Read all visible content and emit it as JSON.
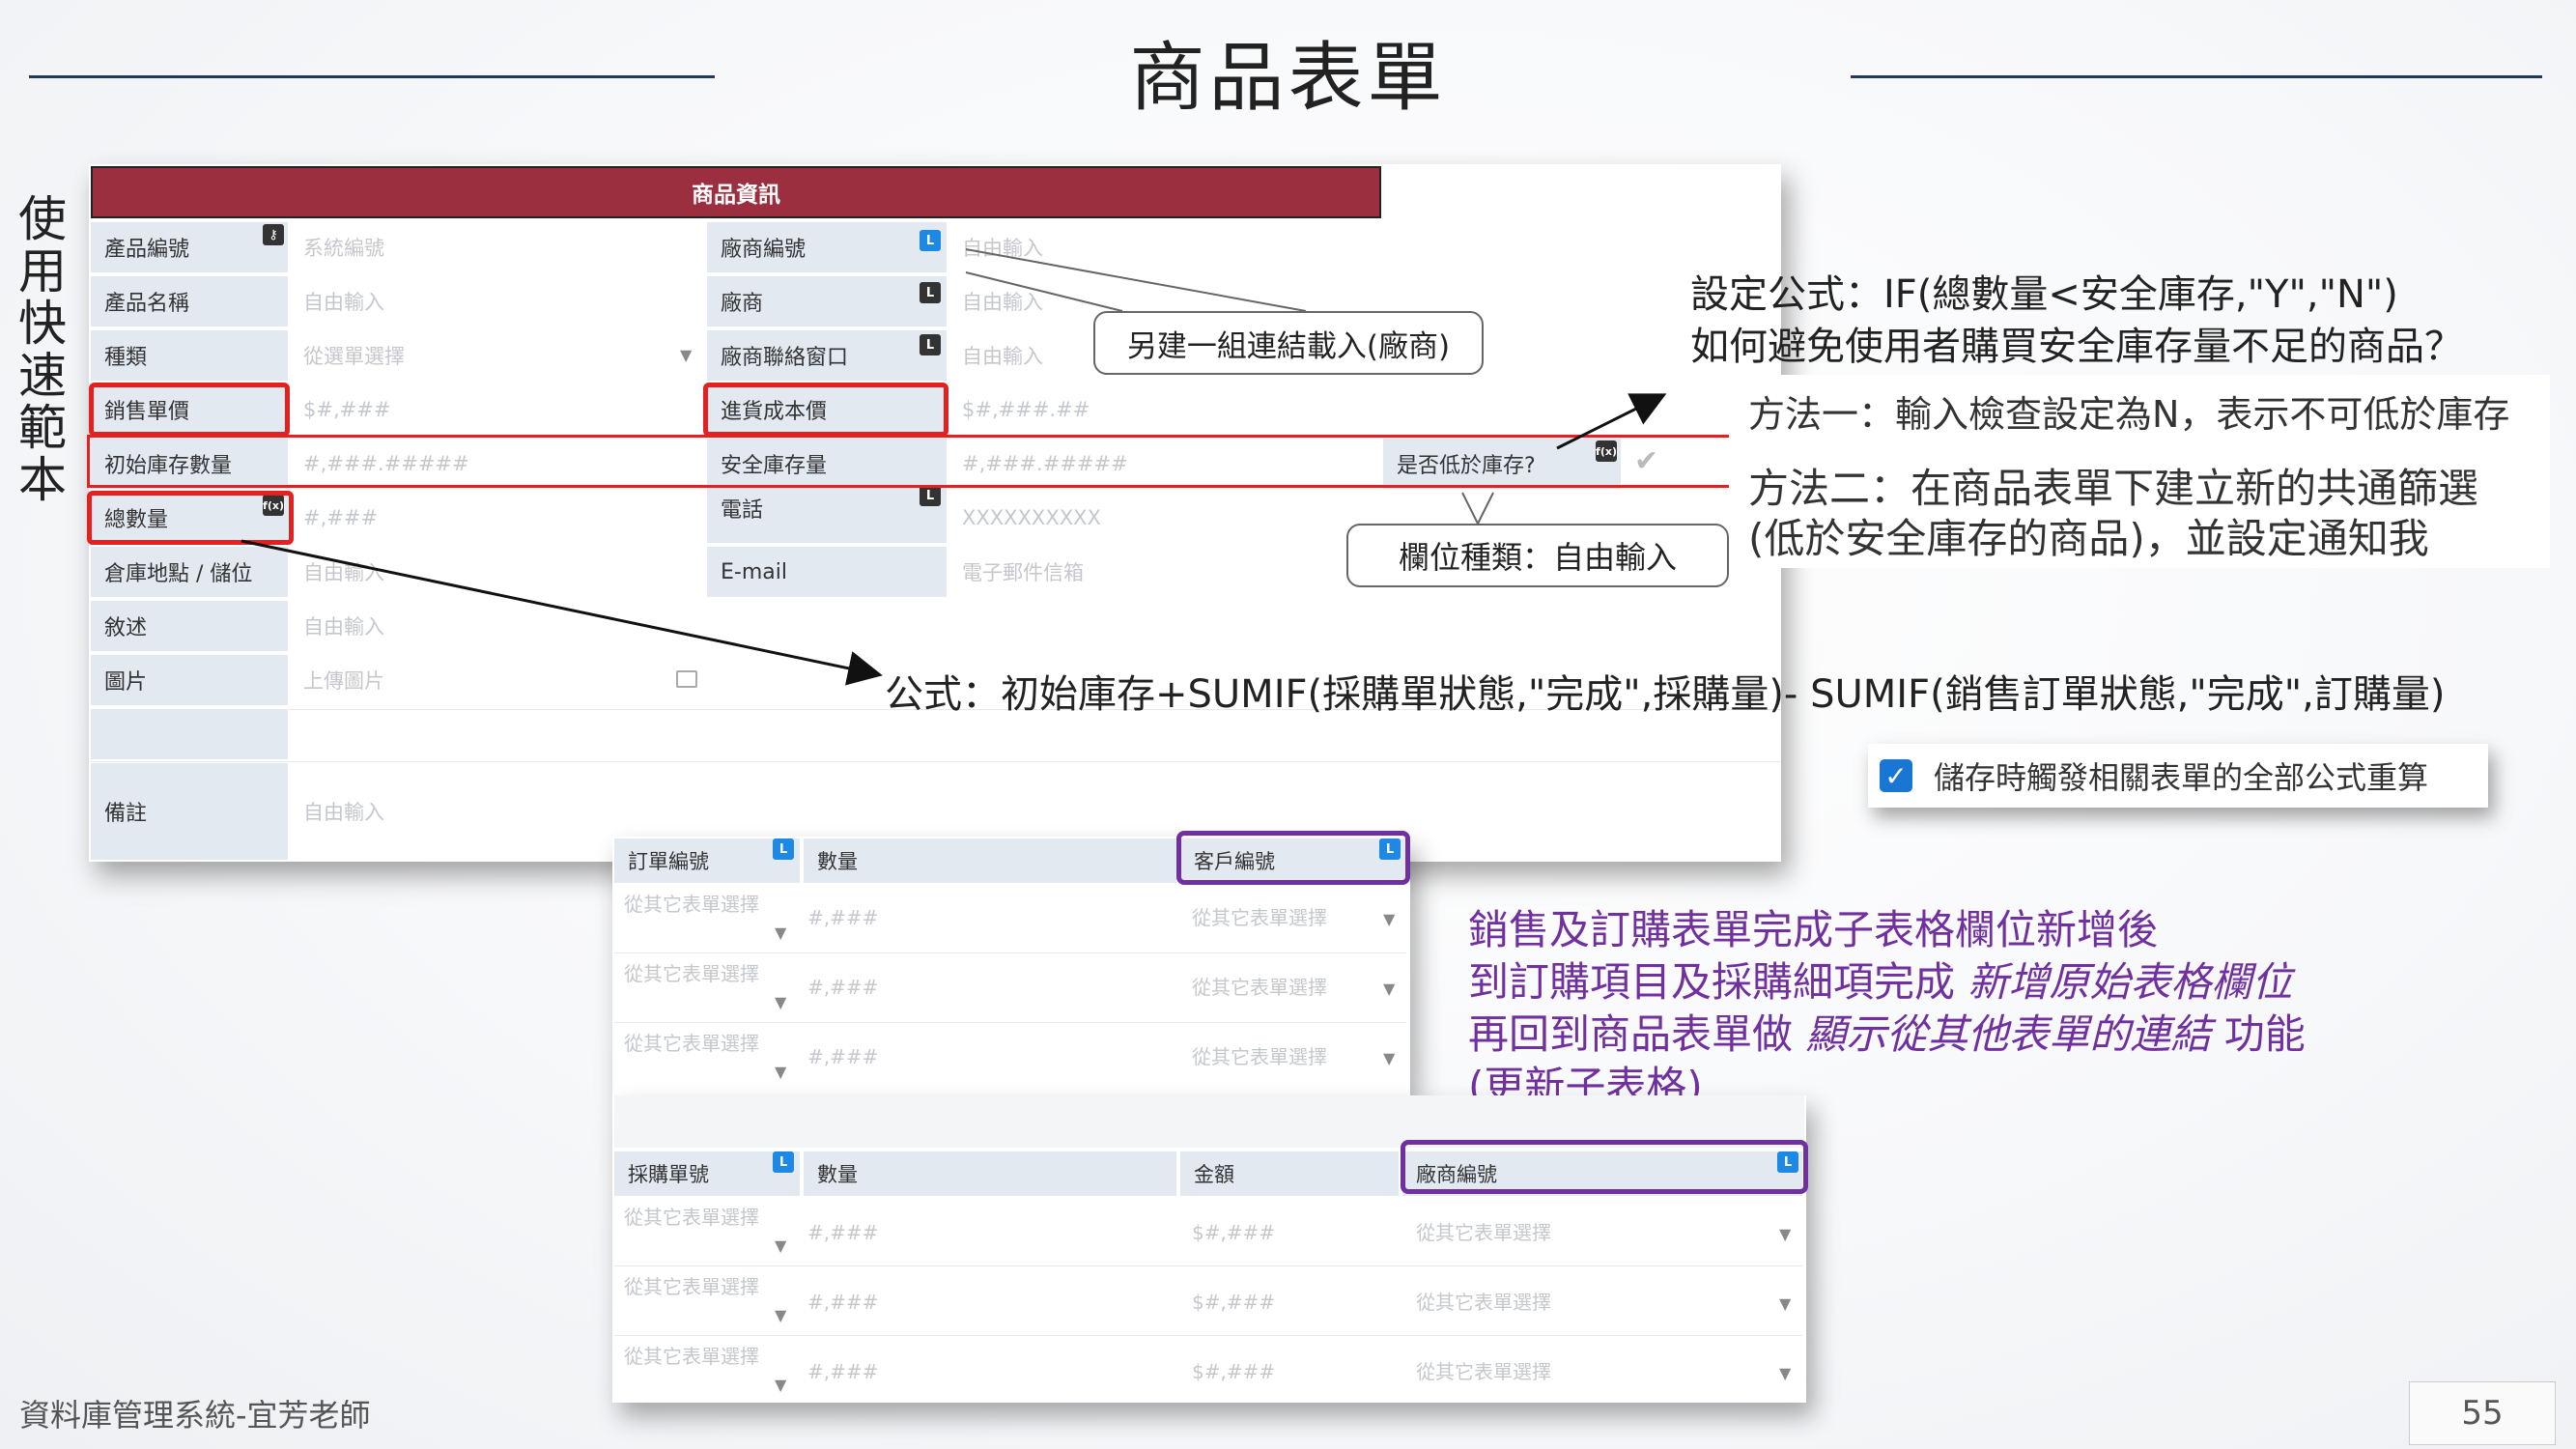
{
  "title": "商品表單",
  "side_title": "使用快速範本",
  "form": {
    "header": "商品資訊",
    "rows": [
      {
        "label": "產品編號",
        "value": "系統編號",
        "label2": "廠商編號",
        "value2": "自由輸入"
      },
      {
        "label": "產品名稱",
        "value": "自由輸入",
        "label2": "廠商",
        "value2": "自由輸入"
      },
      {
        "label": "種類",
        "value": "從選單選擇",
        "label2": "廠商聯絡窗口",
        "value2": "自由輸入"
      },
      {
        "label": "銷售單價",
        "value": "$#,###",
        "label2": "進貨成本價",
        "value2": "$#,###.##"
      },
      {
        "label": "初始庫存數量",
        "value": "#,###.#####",
        "label2": "安全庫存量",
        "value2": "#,###.#####",
        "label3": "是否低於庫存?"
      },
      {
        "label": "總數量",
        "value": "#,###",
        "label2": "電話",
        "value2": "XXXXXXXXXX"
      },
      {
        "label": "倉庫地點 / 儲位",
        "value": "自由輸入",
        "label2": "E-mail",
        "value2": "電子郵件信箱"
      },
      {
        "label": "敘述",
        "value": "自由輸入"
      },
      {
        "label": "圖片",
        "value": "上傳圖片"
      },
      {
        "label": "備註",
        "value": "自由輸入"
      }
    ]
  },
  "callouts": {
    "link": "另建一組連結載入(廠商)",
    "field_type": "欄位種類：自由輸入"
  },
  "notes": {
    "formula_line1": "設定公式：IF(總數量<安全庫存,\"Y\",\"N\")",
    "formula_line2": "如何避免使用者購買安全庫存量不足的商品？",
    "method1": "方法一：輸入檢查設定為N，表示不可低於庫存",
    "method2_line1": "方法二：在商品表單下建立新的共通篩選",
    "method2_line2": "(低於安全庫存的商品)，並設定通知我",
    "sum_formula": "公式：初始庫存+SUMIF(採購單狀態,\"完成\",採購量)- SUMIF(銷售訂單狀態,\"完成\",訂購量)"
  },
  "checkbox": {
    "label": "儲存時觸發相關表單的全部公式重算",
    "checked": true
  },
  "purple_note": {
    "line1": "銷售及訂購表單完成子表格欄位新增後",
    "line2_a": "到訂購項目及採購細項完成 ",
    "line2_b": "新增原始表格欄位",
    "line3_a": "再回到商品表單做 ",
    "line3_b": "顯示從其他表單的連結",
    "line3_c": " 功能",
    "line4": "(更新子表格)"
  },
  "order_table": {
    "headers": [
      "訂單編號",
      "數量",
      "客戶編號"
    ],
    "rows": [
      [
        "從其它表單選擇",
        "#,###",
        "從其它表單選擇"
      ],
      [
        "從其它表單選擇",
        "#,###",
        "從其它表單選擇"
      ],
      [
        "從其它表單選擇",
        "#,###",
        "從其它表單選擇"
      ]
    ]
  },
  "purchase_table": {
    "headers": [
      "採購單號",
      "數量",
      "金額",
      "廠商編號"
    ],
    "rows": [
      [
        "從其它表單選擇",
        "#,###",
        "$#,###",
        "從其它表單選擇"
      ],
      [
        "從其它表單選擇",
        "#,###",
        "$#,###",
        "從其它表單選擇"
      ],
      [
        "從其它表單選擇",
        "#,###",
        "$#,###",
        "從其它表單選擇"
      ]
    ]
  },
  "footer": "資料庫管理系統-宜芳老師",
  "page_number": "55",
  "badges": {
    "link": "L",
    "formula": "f(x)"
  },
  "colors": {
    "header": "#9c2f3f",
    "highlight_red": "#e52020",
    "highlight_purple": "#7030a0",
    "badge_blue": "#1e88e5"
  }
}
